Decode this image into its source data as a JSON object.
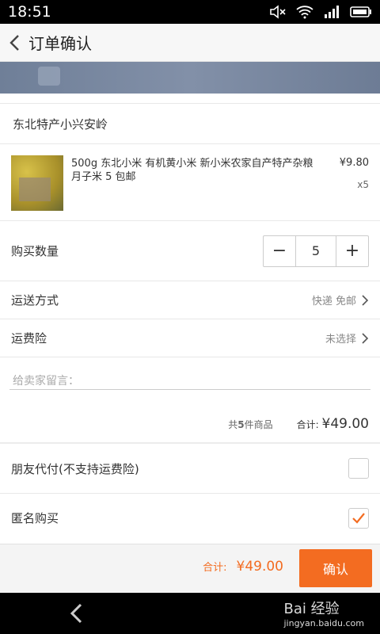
{
  "status": {
    "time": "18:51"
  },
  "header": {
    "title": "订单确认"
  },
  "shop": {
    "name": "东北特产小兴安岭"
  },
  "product": {
    "name": "500g 东北小米 有机黄小米 新小米农家自产特产杂粮 月子米 5 包邮",
    "price": "¥9.80",
    "qty": "x5"
  },
  "quantity": {
    "label": "购买数量",
    "minus": "−",
    "value": "5",
    "plus": "+"
  },
  "shipping": {
    "label": "运送方式",
    "value": "快递 免邮"
  },
  "insurance": {
    "label": "运费险",
    "value": "未选择"
  },
  "message": {
    "placeholder": "给卖家留言："
  },
  "summary": {
    "count_prefix": "共",
    "count": "5",
    "count_suffix": "件商品",
    "total_label": "合计:",
    "total": "¥49.00"
  },
  "options": {
    "friend_pay": {
      "label": "朋友代付(不支持运费险)",
      "checked": false
    },
    "anonymous": {
      "label": "匿名购买",
      "checked": true
    }
  },
  "footer": {
    "total_label": "合计:",
    "total": "¥49.00",
    "confirm_label": "确认"
  },
  "watermark": {
    "brand": "Bai 经验",
    "url": "jingyan.baidu.com"
  },
  "colors": {
    "accent": "#f36c21",
    "status_bar": "#000000"
  }
}
